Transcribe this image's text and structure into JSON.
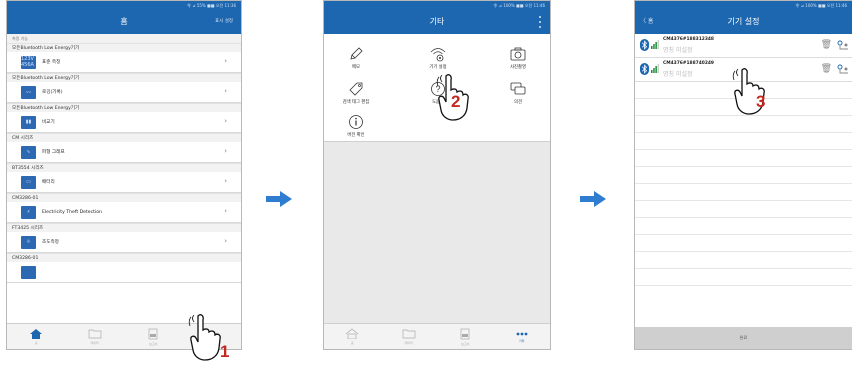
{
  "screen1": {
    "status": "令 ⊿ 55% ■■ 오전 11:36",
    "title": "홈",
    "right_action": "표시 설정",
    "section_header": "측정 기능",
    "groups": [
      {
        "header": "모든Bluetooth Low Energy기기",
        "label": "표준 측정",
        "icon_text": "123V 456A"
      },
      {
        "header": "모든Bluetooth Low Energy기기",
        "label": "로깅(기록)",
        "icon_text": "〰"
      },
      {
        "header": "모든Bluetooth Low Energy기기",
        "label": "비교기",
        "icon_text": "▮▮"
      },
      {
        "header": "CM 시리즈",
        "label": "파형 그래프",
        "icon_text": "∿"
      },
      {
        "header": "BT3554 시리즈",
        "label": "배터리",
        "icon_text": "▭"
      },
      {
        "header": "CM3286-01",
        "label": "Electricity Theft Detection",
        "icon_text": "⚡"
      },
      {
        "header": "FT3425 시리즈",
        "label": "조도측정",
        "icon_text": "☼"
      },
      {
        "header": "CM3286-01",
        "label": "",
        "icon_text": ""
      }
    ],
    "tabs": [
      {
        "icon": "home-icon",
        "label": "홈"
      },
      {
        "icon": "folder-icon",
        "label": "데이터"
      },
      {
        "icon": "report-icon",
        "label": "보고서"
      },
      {
        "icon": "more-icon",
        "label": "기타"
      }
    ]
  },
  "screen2": {
    "status": "令 ⊿ 100% ■■ 오전 11:46",
    "title": "기타",
    "items": [
      {
        "icon": "pencil-icon",
        "label": "메모"
      },
      {
        "icon": "device-settings-icon",
        "label": "기기 설정"
      },
      {
        "icon": "camera-icon",
        "label": "사진촬영"
      },
      {
        "icon": "tag-icon",
        "label": "검색 태그 편집"
      },
      {
        "icon": "help-icon",
        "label": "도움말"
      },
      {
        "icon": "chat-icon",
        "label": "의견"
      },
      {
        "icon": "info-icon",
        "label": "버전 확인"
      }
    ],
    "tabs": [
      {
        "icon": "home-icon",
        "label": "홈"
      },
      {
        "icon": "folder-icon",
        "label": "데이터"
      },
      {
        "icon": "report-icon",
        "label": "보고서"
      },
      {
        "icon": "more-icon",
        "label": "기타"
      }
    ]
  },
  "screen3": {
    "status": "令 ⊿ 100% ■■ 오전 11:46",
    "back": "〈 홈",
    "title": "기기 설정",
    "devices": [
      {
        "name": "CM4376#188312348",
        "status": "명칭 미설정"
      },
      {
        "name": "CM4376#188740249",
        "status": "명칭 미설정"
      }
    ],
    "bottom": "완료"
  },
  "steps": [
    "1",
    "2",
    "3"
  ],
  "colors": {
    "brand_blue": "#1d66b0",
    "step_red": "#c5281f",
    "arrow_blue": "#2f7dd1"
  }
}
